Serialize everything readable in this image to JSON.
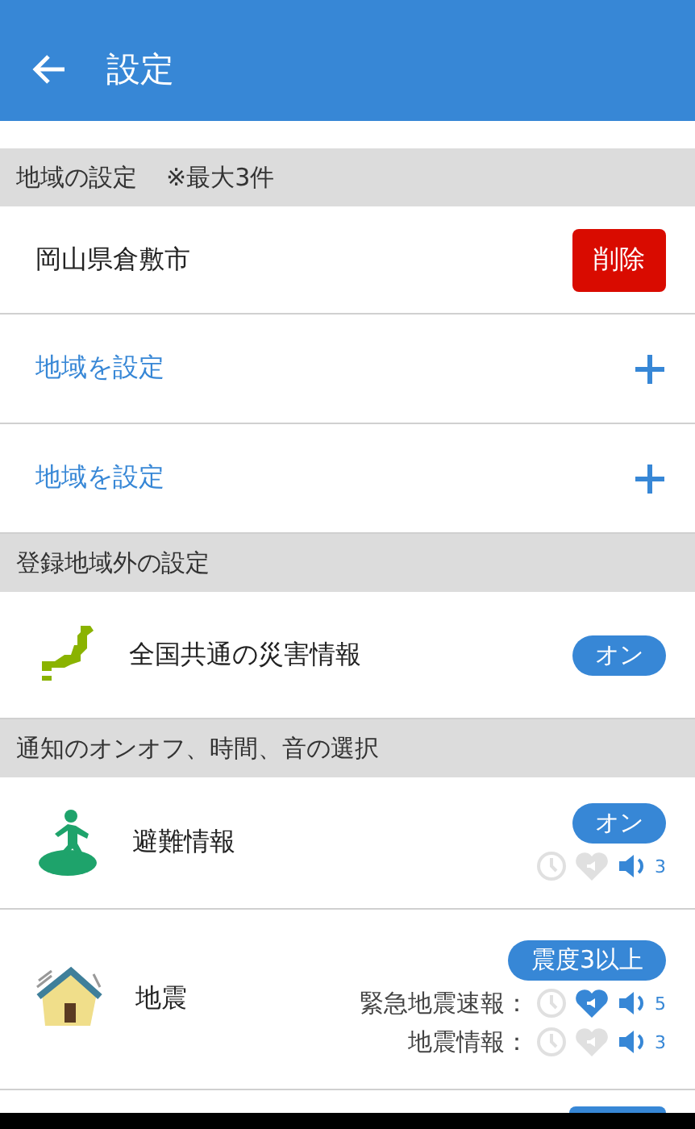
{
  "header": {
    "title": "設定"
  },
  "region_section": {
    "title": "地域の設定",
    "note": "※最大3件"
  },
  "regions": [
    {
      "kind": "set",
      "name": "岡山県倉敷市",
      "action": "削除"
    },
    {
      "kind": "empty",
      "name": "地域を設定"
    },
    {
      "kind": "empty",
      "name": "地域を設定"
    }
  ],
  "outside_section": {
    "title": "登録地域外の設定"
  },
  "outside_item": {
    "name": "全国共通の災害情報",
    "toggle": "オン"
  },
  "notify_section": {
    "title": "通知のオンオフ、時間、音の選択"
  },
  "notifications": [
    {
      "kind": "evacuation",
      "name": "避難情報",
      "badge": "オン",
      "settings": [
        {
          "time": false,
          "vibrate": false,
          "volume": "3"
        }
      ]
    },
    {
      "kind": "earthquake",
      "name": "地震",
      "badge": "震度3以上",
      "settings": [
        {
          "label": "緊急地震速報：",
          "time": false,
          "vibrate": true,
          "volume": "5"
        },
        {
          "label": "地震情報：",
          "time": false,
          "vibrate": false,
          "volume": "3"
        }
      ]
    }
  ]
}
